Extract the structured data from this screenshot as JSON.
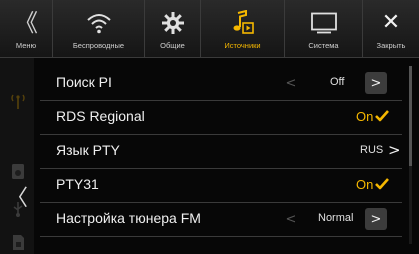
{
  "tabs": [
    {
      "label": "Меню",
      "icon": "back-chevron-icon"
    },
    {
      "label": "Беспроводные",
      "icon": "wireless-icon"
    },
    {
      "label": "Общие",
      "icon": "gear-icon"
    },
    {
      "label": "Источники",
      "icon": "source-music-icon"
    },
    {
      "label": "Система",
      "icon": "monitor-icon"
    },
    {
      "label": "Закрыть",
      "icon": "close-icon"
    }
  ],
  "glyphs": {
    "back": "《",
    "close": "✕",
    "left": "〈",
    "step_left": "<",
    "step_right": ">",
    "chev": "〉"
  },
  "colors": {
    "accent": "#f5b700",
    "background": "#070707",
    "divider": "#3a3a3a"
  },
  "rows": [
    {
      "label": "Поиск PI",
      "value": "Off",
      "control": "stepper"
    },
    {
      "label": "RDS Regional",
      "value": "On",
      "control": "toggle-check"
    },
    {
      "label": "Язык PTY",
      "value": "RUS",
      "control": "submenu"
    },
    {
      "label": "PTY31",
      "value": "On",
      "control": "toggle-check"
    },
    {
      "label": "Настройка тюнера FM",
      "value": "Normal",
      "control": "stepper"
    }
  ],
  "side_icons": [
    "antenna-icon",
    "speaker-icon",
    "usb-icon",
    "sd-card-icon"
  ]
}
